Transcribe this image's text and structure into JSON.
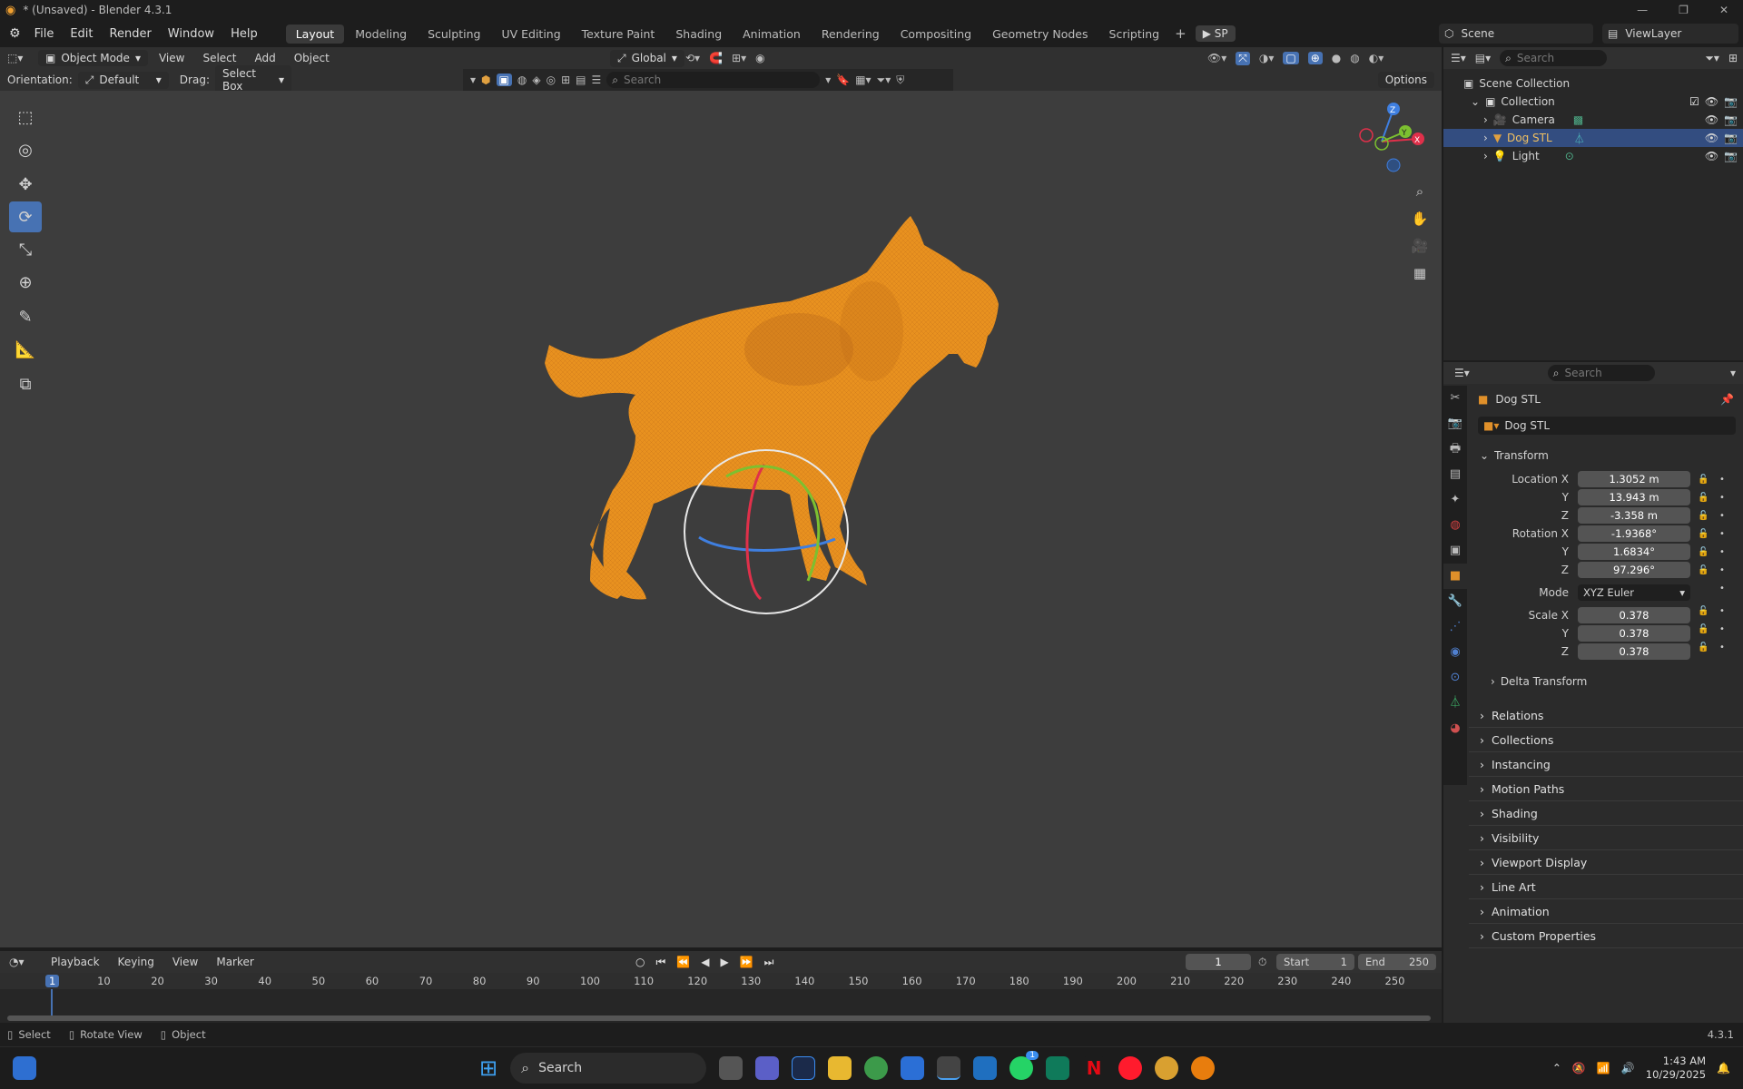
{
  "window": {
    "title": "* (Unsaved) - Blender 4.3.1"
  },
  "menu": [
    "File",
    "Edit",
    "Render",
    "Window",
    "Help"
  ],
  "workspaces": [
    {
      "label": "Layout",
      "active": true
    },
    {
      "label": "Modeling"
    },
    {
      "label": "Sculpting"
    },
    {
      "label": "UV Editing"
    },
    {
      "label": "Texture Paint"
    },
    {
      "label": "Shading"
    },
    {
      "label": "Animation"
    },
    {
      "label": "Rendering"
    },
    {
      "label": "Compositing"
    },
    {
      "label": "Geometry Nodes"
    },
    {
      "label": "Scripting"
    }
  ],
  "sp_button": "SP",
  "scene": {
    "label": "Scene",
    "view_layer": "ViewLayer"
  },
  "viewport_header": {
    "mode": "Object Mode",
    "menus": [
      "View",
      "Select",
      "Add",
      "Object"
    ],
    "transform_orientation": "Global"
  },
  "tool_header": {
    "orientation_label": "Orientation:",
    "orientation_value": "Default",
    "drag_label": "Drag:",
    "drag_value": "Select Box",
    "search_placeholder": "Search",
    "options": "Options"
  },
  "gizmo_axes": {
    "x": "X",
    "y": "Y",
    "z": "Z"
  },
  "outliner": {
    "search_placeholder": "Search",
    "root": "Scene Collection",
    "collection": "Collection",
    "items": [
      {
        "label": "Camera",
        "selected": false
      },
      {
        "label": "Dog STL",
        "selected": true
      },
      {
        "label": "Light",
        "selected": false
      }
    ]
  },
  "properties": {
    "search_placeholder": "Search",
    "object_name": "Dog STL",
    "datablock": "Dog STL",
    "transform_title": "Transform",
    "location": {
      "label": "Location X",
      "x": "1.3052 m",
      "y": "13.943 m",
      "z": "-3.358 m"
    },
    "rotation": {
      "label": "Rotation X",
      "x": "-1.9368°",
      "y": "1.6834°",
      "z": "97.296°"
    },
    "mode": {
      "label": "Mode",
      "value": "XYZ Euler"
    },
    "scale": {
      "label": "Scale X",
      "x": "0.378",
      "y": "0.378",
      "z": "0.378"
    },
    "axis_y": "Y",
    "axis_z": "Z",
    "delta": "Delta Transform",
    "sections": [
      "Relations",
      "Collections",
      "Instancing",
      "Motion Paths",
      "Shading",
      "Visibility",
      "Viewport Display",
      "Line Art",
      "Animation",
      "Custom Properties"
    ]
  },
  "timeline": {
    "menus": [
      "Playback",
      "Keying",
      "View",
      "Marker"
    ],
    "current_frame": "1",
    "start_label": "Start",
    "start": "1",
    "end_label": "End",
    "end": "250",
    "ticks": [
      "1",
      "10",
      "20",
      "30",
      "40",
      "50",
      "60",
      "70",
      "80",
      "90",
      "100",
      "110",
      "120",
      "130",
      "140",
      "150",
      "160",
      "170",
      "180",
      "190",
      "200",
      "210",
      "220",
      "230",
      "240",
      "250"
    ]
  },
  "status": {
    "select": "Select",
    "rotate": "Rotate View",
    "object": "Object",
    "version": "4.3.1"
  },
  "taskbar": {
    "search": "Search",
    "time": "1:43 AM",
    "date": "10/29/2025",
    "badge": "1"
  },
  "colors": {
    "accent": "#4772b3",
    "dog": "#e8911f",
    "select_row": "#334d80"
  }
}
